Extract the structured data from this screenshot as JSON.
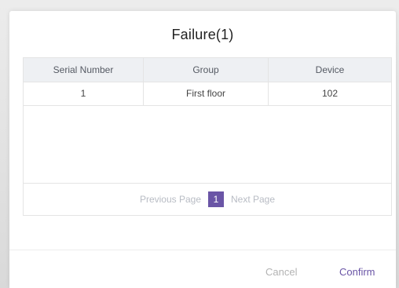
{
  "dialog": {
    "title": "Failure(1)",
    "table": {
      "headers": [
        "Serial Number",
        "Group",
        "Device"
      ],
      "rows": [
        [
          "1",
          "First floor",
          "102"
        ]
      ]
    },
    "pagination": {
      "prev_label": "Previous Page",
      "current_page": "1",
      "next_label": "Next Page"
    },
    "buttons": {
      "cancel_label": "Cancel",
      "confirm_label": "Confirm"
    }
  },
  "colors": {
    "accent": "#6a55a6",
    "header_bg": "#eef0f3",
    "border": "#e4e4e4",
    "muted_text": "#b8bcc4"
  }
}
